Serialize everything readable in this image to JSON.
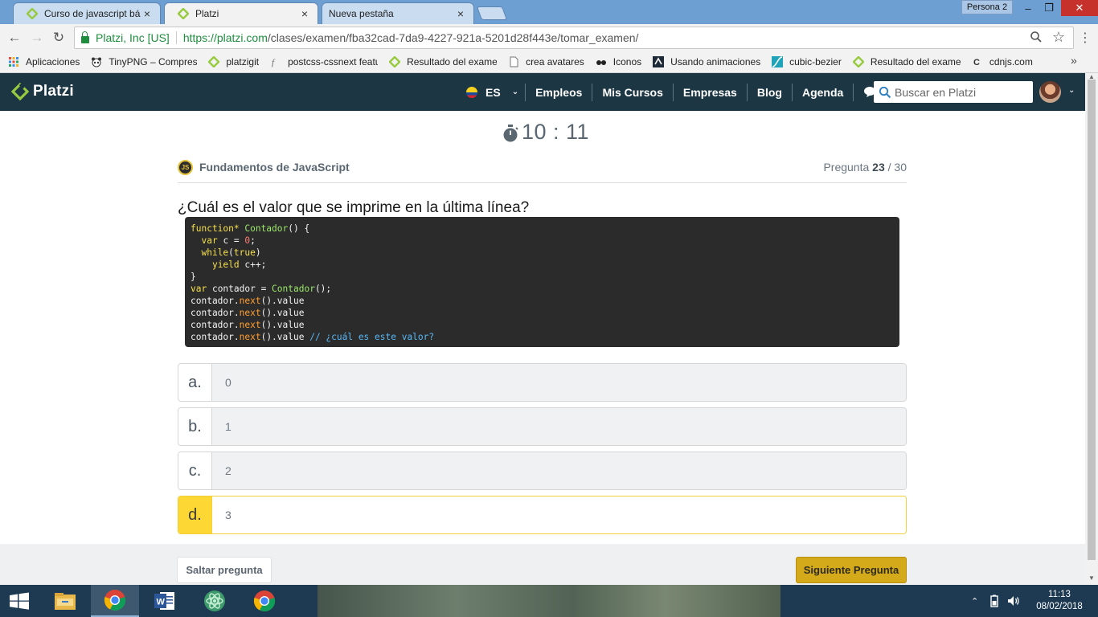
{
  "browser": {
    "tabs": [
      {
        "title": "Curso de javascript básic",
        "close": "×",
        "active": false
      },
      {
        "title": "Platzi",
        "close": "×",
        "active": true
      },
      {
        "title": "Nueva pestaña",
        "close": "×",
        "active": false
      }
    ],
    "profile": "Persona 2",
    "window_controls": {
      "minimize": "–",
      "maximize": "❐",
      "close": "✕"
    },
    "nav": {
      "back": "←",
      "forward": "→",
      "reload": "↻",
      "menu": "⋮"
    },
    "site_name": "Platzi, Inc [US]",
    "url_host": "https://platzi.com",
    "url_path": "/clases/examen/fba32cad-7da9-4227-921a-5201d28f443e/tomar_examen/",
    "bookmarks": [
      {
        "label": "Aplicaciones",
        "icon": "apps-grid-icon"
      },
      {
        "label": "TinyPNG – Compress",
        "icon": "panda-icon"
      },
      {
        "label": "platzigit",
        "icon": "platzi-icon"
      },
      {
        "label": "postcss-cssnext featu",
        "icon": "postcss-icon"
      },
      {
        "label": "Resultado del exame",
        "icon": "platzi-icon"
      },
      {
        "label": "crea avatares",
        "icon": "page-icon"
      },
      {
        "label": "Iconos",
        "icon": "glasses-icon"
      },
      {
        "label": "Usando animaciones",
        "icon": "mdn-icon"
      },
      {
        "label": "cubic-bezier",
        "icon": "curve-icon"
      },
      {
        "label": "Resultado del exame",
        "icon": "platzi-icon"
      },
      {
        "label": "cdnjs.com",
        "icon": "cdnjs-icon"
      }
    ],
    "bookmarks_more": "»"
  },
  "site": {
    "logo": "Platzi",
    "lang": "ES",
    "lang_caret": "⌄",
    "nav": [
      "Empleos",
      "Mis Cursos",
      "Empresas",
      "Blog",
      "Agenda"
    ],
    "search_placeholder": "Buscar en Platzi",
    "avatar_caret": "⌄"
  },
  "exam": {
    "timer": "10 : 11",
    "course": "Fundamentos de JavaScript",
    "course_icon_text": "JS",
    "question_label": "Pregunta",
    "question_current": "23",
    "question_total": "/ 30",
    "question": "¿Cuál es el valor que se imprime en la última línea?",
    "code_lines": [
      [
        {
          "t": "function* ",
          "c": "kw"
        },
        {
          "t": "Contador",
          "c": "fn"
        },
        {
          "t": "() {",
          "c": ""
        }
      ],
      [
        {
          "t": "  ",
          "c": ""
        },
        {
          "t": "var",
          "c": "kw"
        },
        {
          "t": " c = ",
          "c": ""
        },
        {
          "t": "0",
          "c": "num"
        },
        {
          "t": ";",
          "c": ""
        }
      ],
      [
        {
          "t": "  ",
          "c": ""
        },
        {
          "t": "while",
          "c": "kw"
        },
        {
          "t": "(",
          "c": ""
        },
        {
          "t": "true",
          "c": "kw"
        },
        {
          "t": ")",
          "c": ""
        }
      ],
      [
        {
          "t": "    ",
          "c": ""
        },
        {
          "t": "yield",
          "c": "kw"
        },
        {
          "t": " c++;",
          "c": ""
        }
      ],
      [
        {
          "t": "}",
          "c": ""
        }
      ],
      [
        {
          "t": "var",
          "c": "kw"
        },
        {
          "t": " contador = ",
          "c": ""
        },
        {
          "t": "Contador",
          "c": "fn"
        },
        {
          "t": "();",
          "c": ""
        }
      ],
      [
        {
          "t": "contador.",
          "c": ""
        },
        {
          "t": "next",
          "c": "call"
        },
        {
          "t": "().value",
          "c": ""
        }
      ],
      [
        {
          "t": "contador.",
          "c": ""
        },
        {
          "t": "next",
          "c": "call"
        },
        {
          "t": "().value",
          "c": ""
        }
      ],
      [
        {
          "t": "contador.",
          "c": ""
        },
        {
          "t": "next",
          "c": "call"
        },
        {
          "t": "().value",
          "c": ""
        }
      ],
      [
        {
          "t": "contador.",
          "c": ""
        },
        {
          "t": "next",
          "c": "call"
        },
        {
          "t": "().value ",
          "c": ""
        },
        {
          "t": "// ¿cuál es este valor?",
          "c": "cmt"
        }
      ]
    ],
    "options": [
      {
        "letter": "a.",
        "text": "0",
        "selected": false
      },
      {
        "letter": "b.",
        "text": "1",
        "selected": false
      },
      {
        "letter": "c.",
        "text": "2",
        "selected": false
      },
      {
        "letter": "d.",
        "text": "3",
        "selected": true
      }
    ],
    "skip_label": "Saltar pregunta",
    "next_label": "Siguiente Pregunta"
  },
  "taskbar": {
    "apps": [
      "file-explorer-icon",
      "chrome-icon",
      "word-icon",
      "atom-icon",
      "chrome-icon"
    ],
    "tray_caret": "⌃",
    "time": "11:13",
    "date": "08/02/2018"
  },
  "colors": {
    "header_bg": "#1c3643",
    "accent_yellow": "#fdd835",
    "button_gold": "#d4a91a",
    "platzi_green": "#98ca3f",
    "code_bg": "#2b2b2b"
  }
}
